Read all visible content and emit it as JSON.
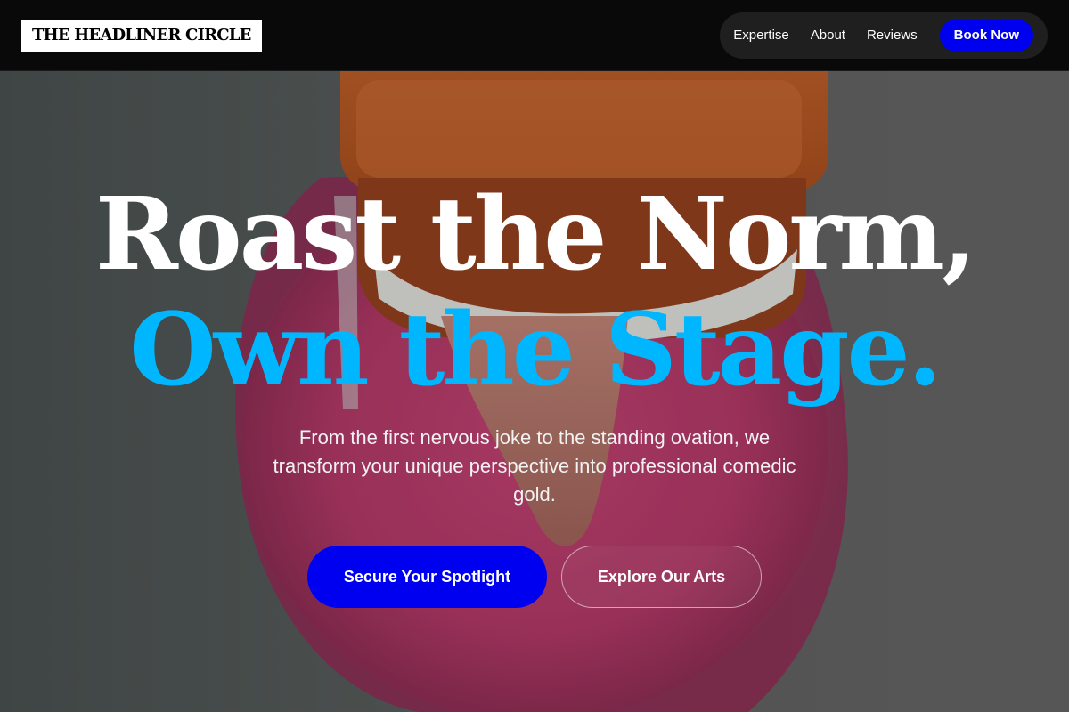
{
  "header": {
    "logo_text": "THE HEADLINER CIRCLE",
    "nav": {
      "expertise": "Expertise",
      "about": "About",
      "reviews": "Reviews",
      "book_now": "Book Now"
    }
  },
  "hero": {
    "headline_line1": "Roast the Norm,",
    "headline_line2": "Own the Stage.",
    "subtitle": "From the first nervous joke to the standing ovation, we transform your unique perspective into professional comedic gold.",
    "primary_cta": "Secure Your Spotlight",
    "secondary_cta": "Explore Our Arts"
  },
  "colors": {
    "accent_blue": "#0000f0",
    "headline_cyan": "#00b7ff",
    "header_bg": "#090909",
    "nav_pill_bg": "#1f1f1f"
  }
}
